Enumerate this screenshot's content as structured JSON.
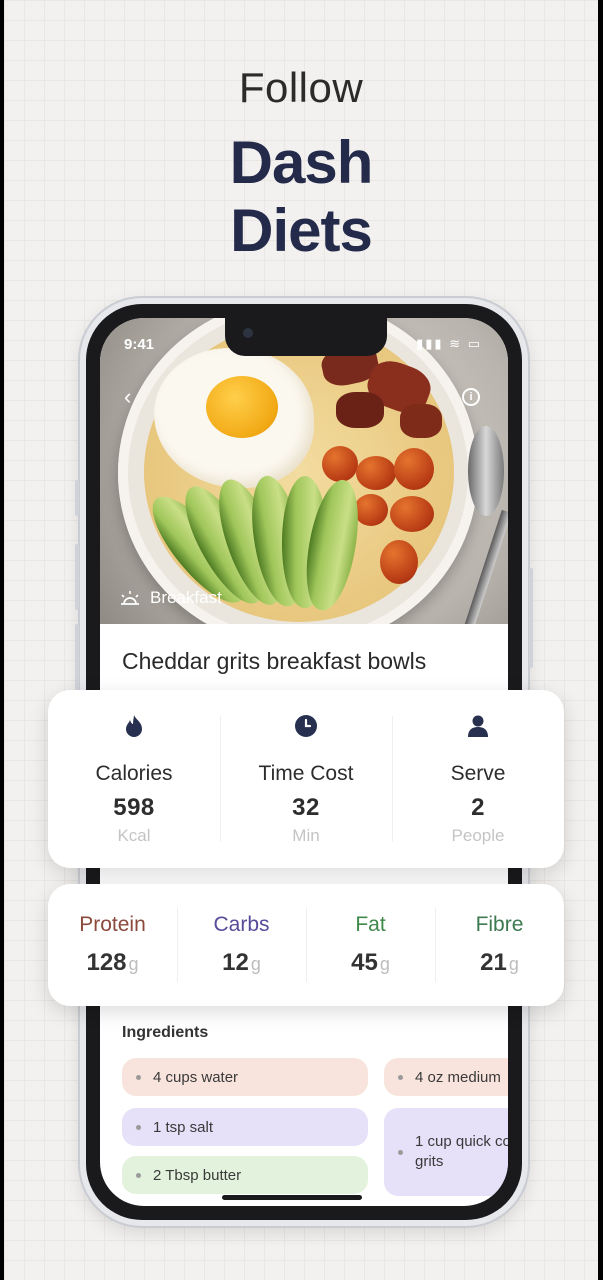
{
  "promo": {
    "line1": "Follow",
    "line2": "Dash",
    "line3": "Diets"
  },
  "status_bar": {
    "time": "9:41",
    "icons": "▮▮▮ ≋ ▭"
  },
  "hero": {
    "meal_type": "Breakfast",
    "meal_icon": "sunrise-icon",
    "back_icon": "chevron-left-icon",
    "info_icon": "info-icon"
  },
  "recipe": {
    "title": "Cheddar grits breakfast bowls"
  },
  "stats": [
    {
      "label": "Calories",
      "value": "598",
      "unit": "Kcal",
      "icon": "flame-icon"
    },
    {
      "label": "Time Cost",
      "value": "32",
      "unit": "Min",
      "icon": "clock-icon"
    },
    {
      "label": "Serve",
      "value": "2",
      "unit": "People",
      "icon": "person-icon"
    }
  ],
  "macros": [
    {
      "name": "Protein",
      "value": "128",
      "unit": "g",
      "color": "#8b4a3c"
    },
    {
      "name": "Carbs",
      "value": "12",
      "unit": "g",
      "color": "#5a4a9a"
    },
    {
      "name": "Fat",
      "value": "45",
      "unit": "g",
      "color": "#3f8a4a"
    },
    {
      "name": "Fibre",
      "value": "21",
      "unit": "g",
      "color": "#3d7a50"
    }
  ],
  "ingredients": {
    "title": "Ingredients",
    "items": [
      {
        "text": "4 cups water",
        "color": "#f8e4dc"
      },
      {
        "text": "4 oz medium",
        "color": "#f8e4dc"
      },
      {
        "text": "1 tsp salt",
        "color": "#e6e0f8"
      },
      {
        "text": "1 cup quick co grits",
        "color": "#e6e0f8"
      },
      {
        "text": "2 Tbsp butter",
        "color": "#e2f2dc"
      }
    ]
  },
  "colors": {
    "headline_navy": "#232a4a",
    "icon_navy": "#27304f"
  }
}
